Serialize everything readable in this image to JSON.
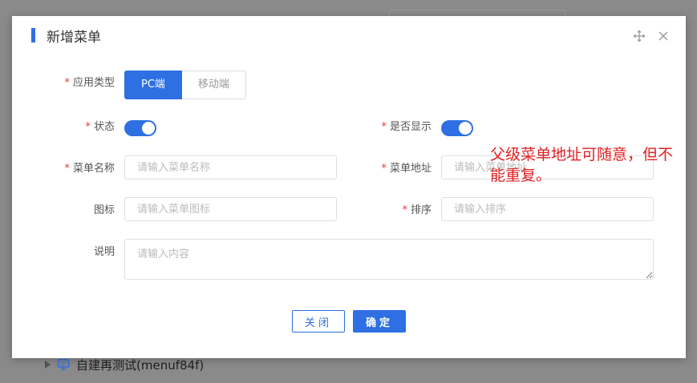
{
  "dialog": {
    "title": "新增菜单"
  },
  "form": {
    "app_type_label": "应用类型",
    "app_type_options": [
      "PC端",
      "移动端"
    ],
    "app_type_selected": "PC端",
    "status_label": "状态",
    "status_on": true,
    "visible_label": "是否显示",
    "visible_on": true,
    "menu_name_label": "菜单名称",
    "menu_name_placeholder": "请输入菜单名称",
    "menu_url_label": "菜单地址",
    "menu_url_placeholder": "请输入菜单地址",
    "icon_label": "图标",
    "icon_placeholder": "请输入菜单图标",
    "sort_label": "排序",
    "sort_placeholder": "请输入排序",
    "desc_label": "说明",
    "desc_placeholder": "请输入内容",
    "required_mark": "*"
  },
  "buttons": {
    "cancel": "关闭",
    "confirm": "确定"
  },
  "annotation": "父级菜单地址可随意，但不能重复。",
  "background": {
    "tree_item": "自建再测试(menuf84f)"
  },
  "colors": {
    "primary": "#2f6fe4",
    "required": "#e4393c",
    "annotation": "#e52020"
  },
  "icons": {
    "move": "move-arrows-icon",
    "close": "close-icon",
    "monitor": "monitor-icon",
    "caret": "caret-right-icon"
  }
}
